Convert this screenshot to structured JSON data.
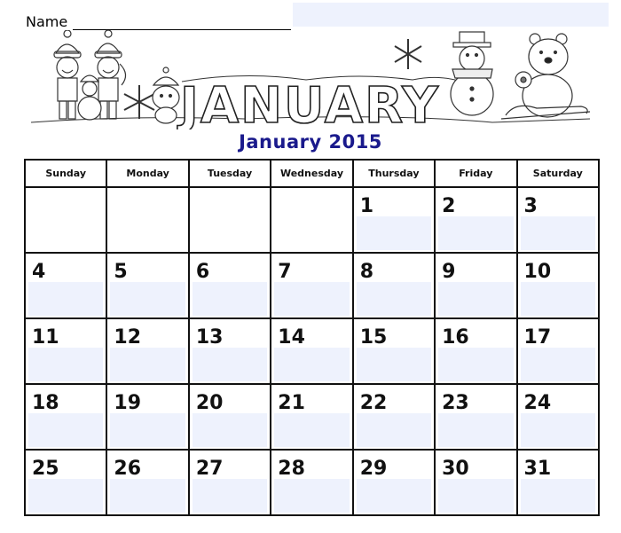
{
  "name_field": {
    "label": "Name",
    "value": ""
  },
  "banner": {
    "heading_art_text": "JANUARY",
    "illustrations": [
      "two-kids-in-winter-hats",
      "small-snowman",
      "snowflake",
      "penguin",
      "snowflake",
      "snowman-with-scarf",
      "polar-bear-on-sled"
    ]
  },
  "calendar": {
    "title": "January 2015",
    "title_color": "#1a1a8c",
    "note_shade_color": "#eef2fd",
    "weekdays": [
      "Sunday",
      "Monday",
      "Tuesday",
      "Wednesday",
      "Thursday",
      "Friday",
      "Saturday"
    ],
    "weeks": [
      [
        "",
        "",
        "",
        "",
        "1",
        "2",
        "3"
      ],
      [
        "4",
        "5",
        "6",
        "7",
        "8",
        "9",
        "10"
      ],
      [
        "11",
        "12",
        "13",
        "14",
        "15",
        "16",
        "17"
      ],
      [
        "18",
        "19",
        "20",
        "21",
        "22",
        "23",
        "24"
      ],
      [
        "25",
        "26",
        "27",
        "28",
        "29",
        "30",
        "31"
      ]
    ]
  }
}
